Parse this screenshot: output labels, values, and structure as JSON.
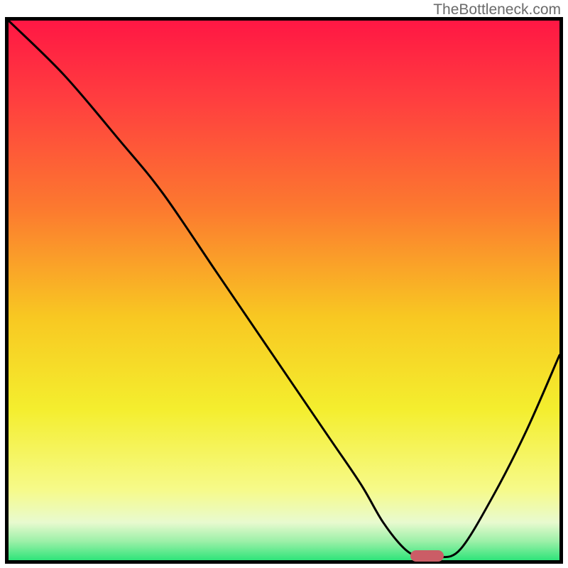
{
  "watermark": "TheBottleneck.com",
  "chart_data": {
    "type": "line",
    "title": "",
    "xlabel": "",
    "ylabel": "",
    "xlim": [
      0,
      100
    ],
    "ylim": [
      0,
      100
    ],
    "grid": false,
    "legend": false,
    "gradient_stops": [
      {
        "offset": 0.0,
        "color": "#ff1744"
      },
      {
        "offset": 0.15,
        "color": "#ff3f3f"
      },
      {
        "offset": 0.35,
        "color": "#fc7a2f"
      },
      {
        "offset": 0.55,
        "color": "#f8c822"
      },
      {
        "offset": 0.72,
        "color": "#f4ee2e"
      },
      {
        "offset": 0.87,
        "color": "#f6fa8a"
      },
      {
        "offset": 0.93,
        "color": "#e8facf"
      },
      {
        "offset": 0.965,
        "color": "#9cf0a8"
      },
      {
        "offset": 1.0,
        "color": "#2fe47a"
      }
    ],
    "curve": {
      "x": [
        0,
        10,
        20,
        28,
        38,
        48,
        58,
        64,
        68,
        72,
        75,
        78,
        82,
        88,
        94,
        100
      ],
      "y": [
        100,
        90,
        78,
        68,
        53,
        38,
        23,
        14,
        7,
        2,
        0.5,
        0.5,
        2,
        12,
        24,
        38
      ]
    },
    "marker": {
      "x": 76,
      "y": 0.8,
      "w": 6,
      "h": 2,
      "color": "#cb5d66"
    }
  }
}
